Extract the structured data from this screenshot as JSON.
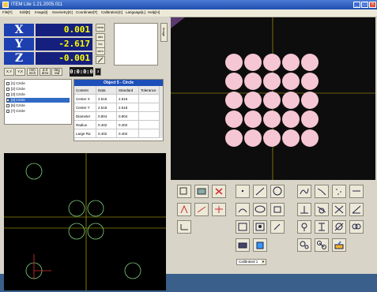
{
  "app": {
    "title": "ITEM Lite 1.21.2005.011"
  },
  "menu": [
    "File[F]",
    "Edit[E]",
    "Image[I]",
    "Geometry[G]",
    "Coordinate[T]",
    "Calibration[C]",
    "Language[L]",
    "Help[H]"
  ],
  "readouts": [
    {
      "axis": "X",
      "value": "0.001"
    },
    {
      "axis": "Y",
      "value": "-2.617"
    },
    {
      "axis": "Z",
      "value": "-0.001"
    }
  ],
  "side_buttons": [
    "clear",
    "abs",
    "inc",
    "zero",
    ""
  ],
  "preview_tab": "Image",
  "toolbar": {
    "xy": "X,Y",
    "yx": "Y,X",
    "mm": "mm inch",
    "ab": "d.d dms",
    "deg": "deg rad",
    "timer": "0:0:0:0",
    "count": "3"
  },
  "objects": [
    {
      "label": "[1] Circle",
      "selected": false
    },
    {
      "label": "[2] Circle",
      "selected": false
    },
    {
      "label": "[3] Circle",
      "selected": false
    },
    {
      "label": "[4] Circle",
      "selected": true
    },
    {
      "label": "[5] Circle",
      "selected": false
    },
    {
      "label": "[7] Circle",
      "selected": false
    }
  ],
  "object_table": {
    "title": "Object 5 - Circle",
    "columns": [
      "Content",
      "Data",
      "Standard",
      "Tolerance"
    ],
    "rows": [
      [
        "Center X",
        "2.516",
        "2.516",
        ""
      ],
      [
        "Center Y",
        "2.518",
        "2.518",
        ""
      ],
      [
        "Diameter",
        "0.804",
        "0.804",
        ""
      ],
      [
        "Radius",
        "0.402",
        "0.402",
        ""
      ],
      [
        "Large Ra",
        "0.402",
        "0.402",
        ""
      ]
    ]
  },
  "calibration_select": "Calibrated 1",
  "colors": {
    "title_bar": "#1f4fb0",
    "readout_label": "#1d3fb0",
    "readout_value": "#ffff00",
    "circle_fill": "#f5c6d4",
    "crosshair": "#c8b400"
  }
}
